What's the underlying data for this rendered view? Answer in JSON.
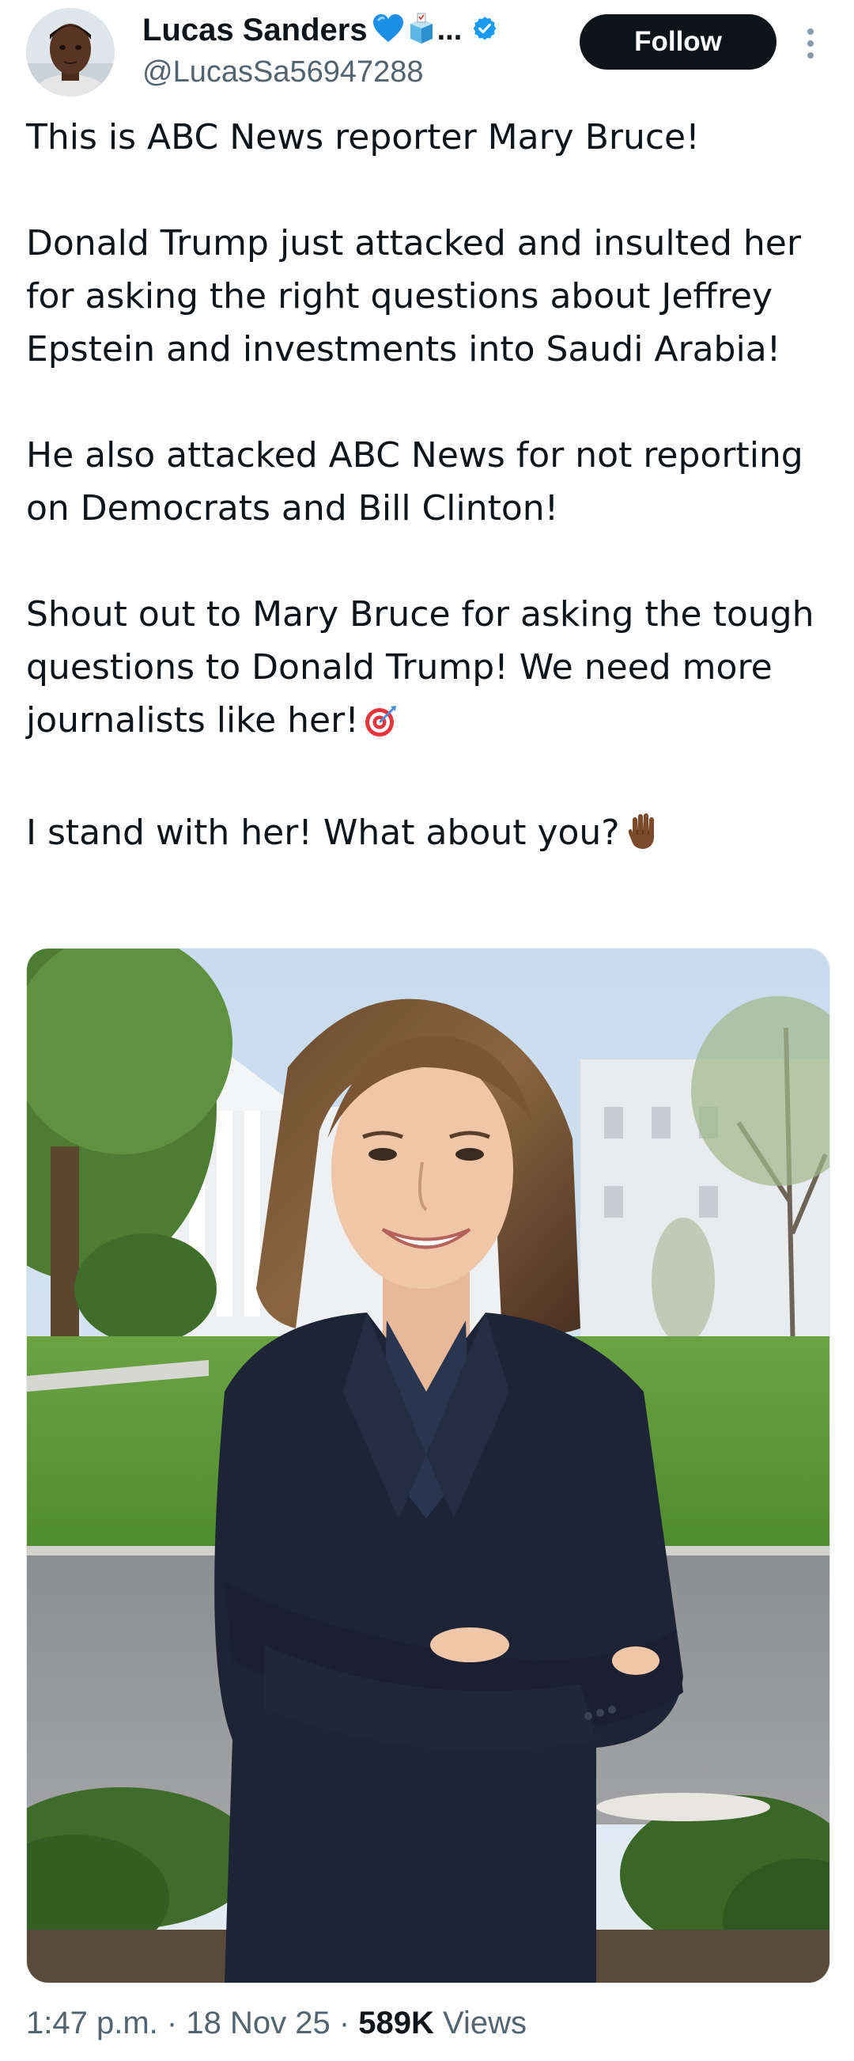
{
  "author": {
    "display_name": "Lucas Sanders",
    "name_ellipsis": "...",
    "handle": "@LucasSa56947288",
    "badge_icons": [
      "blue-heart-icon",
      "ballot-box-icon",
      "verified-badge-icon"
    ]
  },
  "actions": {
    "follow_label": "Follow",
    "more_icon": "more-vertical-icon"
  },
  "tweet": {
    "paragraphs": [
      "This is ABC News reporter Mary Bruce!",
      "Donald Trump just attacked and insulted her for asking the right questions about Jeffrey Epstein and investments into Saudi Arabia!",
      "He also attacked ABC News for not reporting on Democrats and Bill Clinton!",
      "Shout out to Mary Bruce for asking the tough questions to Donald Trump! We need more journalists like her!",
      "I stand with her! What about you?"
    ],
    "emojis": {
      "p4": "direct-hit-icon",
      "p5": "raised-hand-icon"
    }
  },
  "media": {
    "type": "photo"
  },
  "meta": {
    "time": "1:47 p.m.",
    "separator": "·",
    "date": "18 Nov 25",
    "views_count": "589K",
    "views_label": "Views"
  },
  "colors": {
    "text_primary": "#0f1419",
    "text_secondary": "#536471",
    "verified_blue": "#1d9bf0",
    "follow_bg": "#0f1419"
  }
}
